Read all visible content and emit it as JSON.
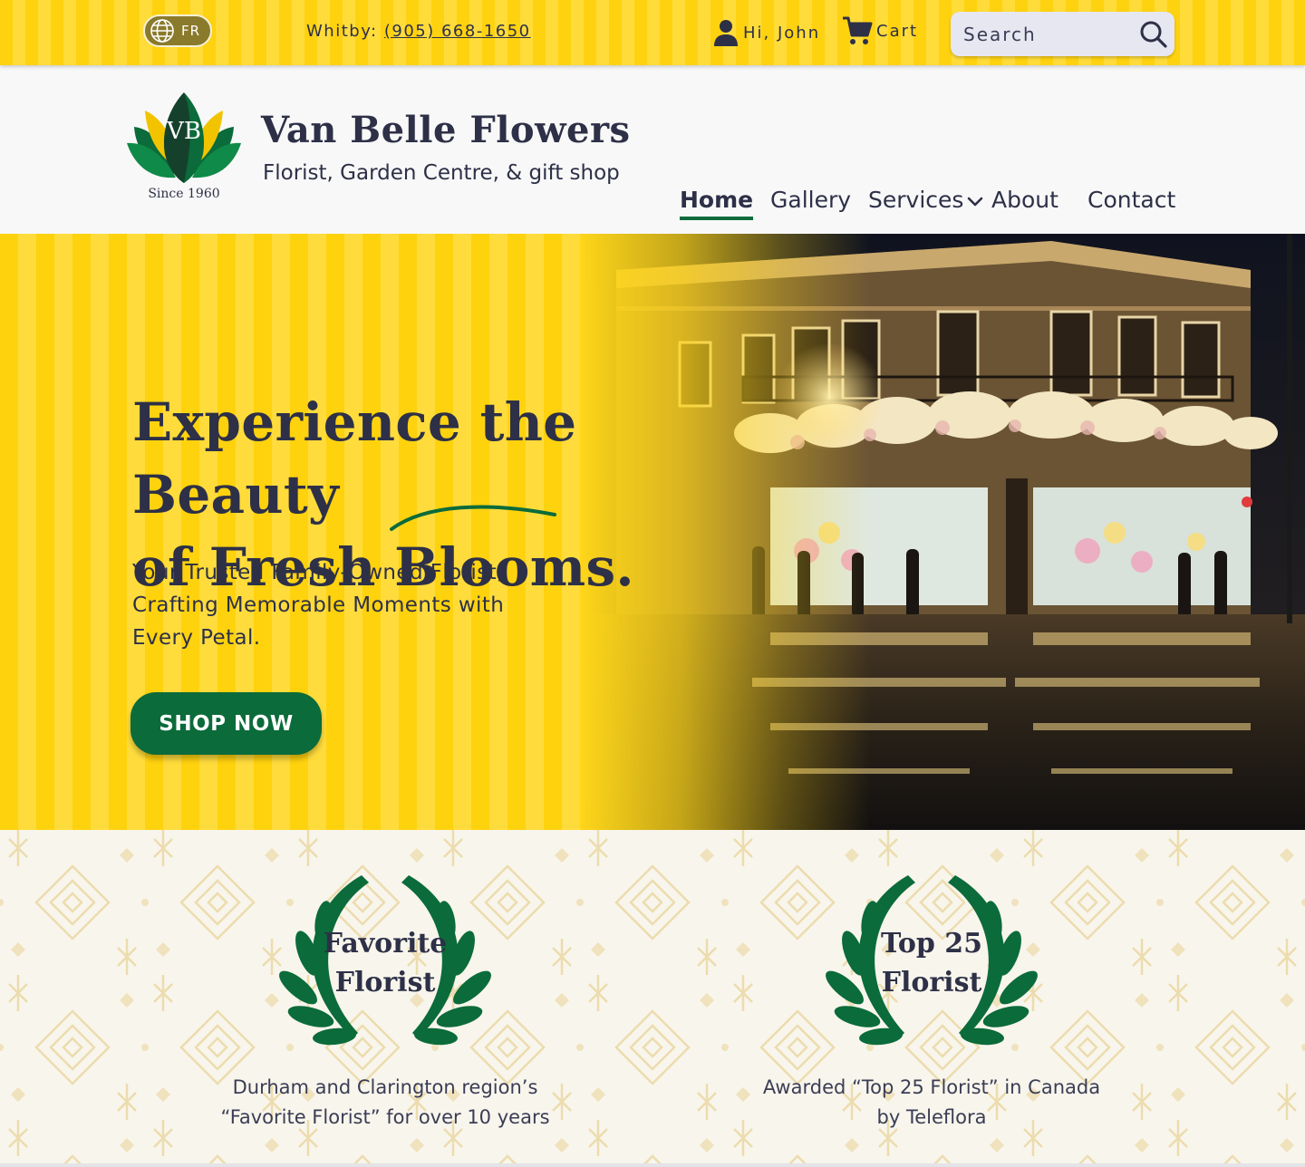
{
  "topbar": {
    "lang_label": "FR",
    "phone_prefix": "Whitby:",
    "phone_number": "(905) 668-1650",
    "greeting": "Hi, John",
    "cart_label": "Cart",
    "search_placeholder": "Search"
  },
  "brand": {
    "logo_monogram": "VB",
    "since": "Since 1960",
    "name": "Van Belle Flowers",
    "tagline": "Florist, Garden Centre, & gift shop"
  },
  "nav": {
    "items": [
      {
        "label": "Home",
        "active": true
      },
      {
        "label": "Gallery"
      },
      {
        "label": "Services",
        "has_dropdown": true
      },
      {
        "label": "About"
      },
      {
        "label": "Contact"
      }
    ]
  },
  "hero": {
    "heading_line1": "Experience the Beauty",
    "heading_line2": "of Fresh Blooms.",
    "subtext": "Your Trusted Family-Owned Florist, Crafting Memorable Moments with Every Petal.",
    "cta": "SHOP NOW"
  },
  "awards": [
    {
      "title_line1": "Favorite",
      "title_line2": "Florist",
      "desc_line1": "Durham and Clarington region’s",
      "desc_line2": "“Favorite Florist” for over 10 years"
    },
    {
      "title_line1": "Top 25",
      "title_line2": "Florist",
      "desc_line1": "Awarded “Top 25 Florist” in Canada",
      "desc_line2": "by Teleflora"
    }
  ],
  "colors": {
    "brand_yellow": "#ffd20e",
    "brand_green": "#0b6b3a",
    "text_navy": "#2d3047"
  },
  "icons": [
    "globe-icon",
    "user-icon",
    "cart-icon",
    "search-icon",
    "chevron-down-icon",
    "wreath-icon"
  ]
}
